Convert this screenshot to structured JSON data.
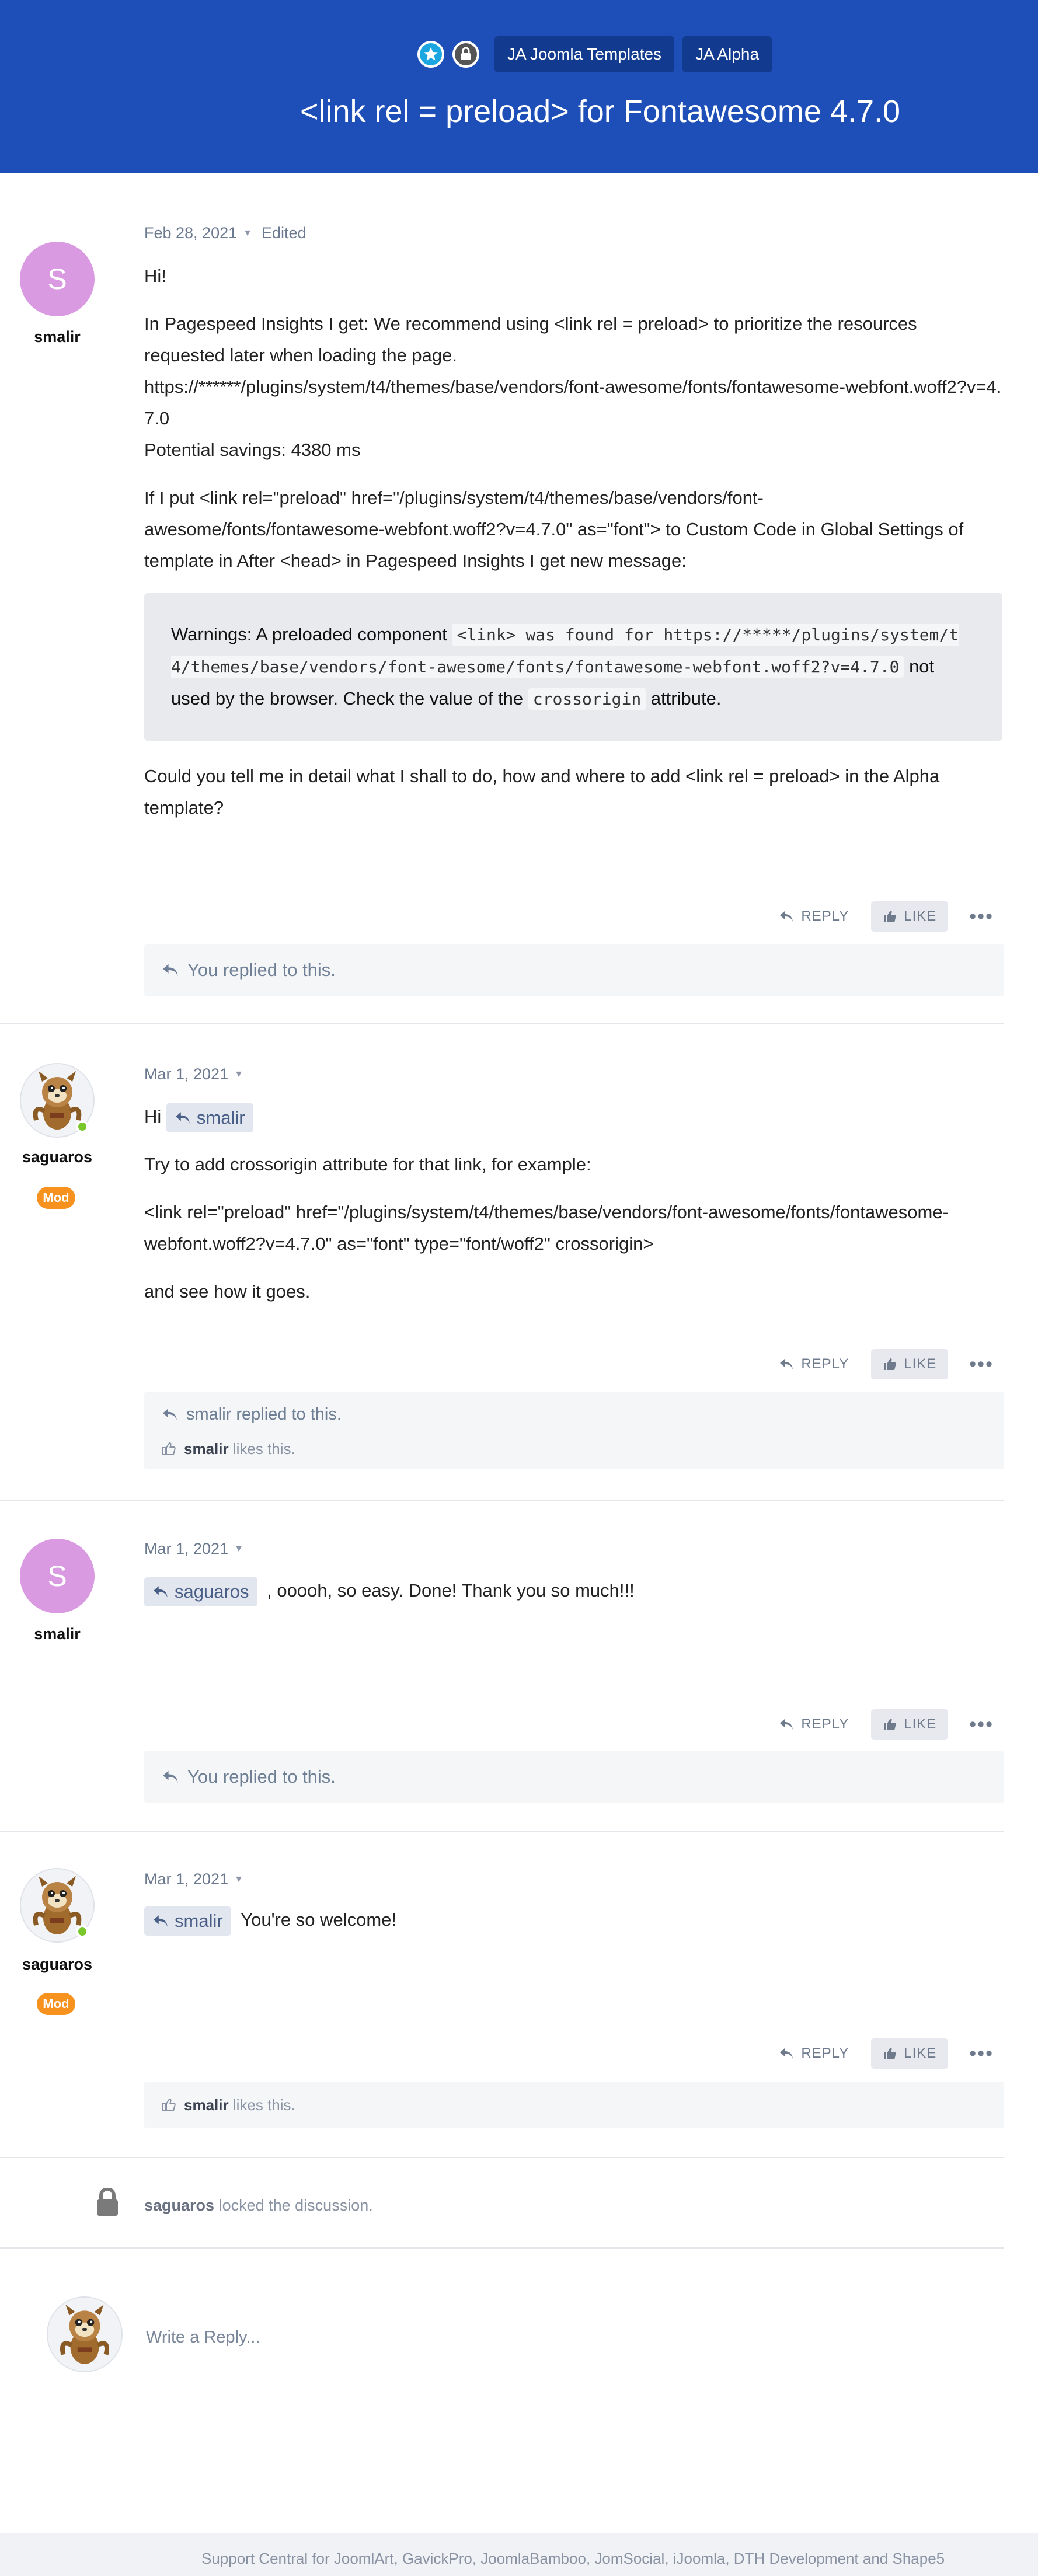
{
  "header": {
    "title": "<link rel = preload> for Fontawesome 4.7.0",
    "tags": [
      "JA Joomla Templates",
      "JA Alpha"
    ]
  },
  "posts": [
    {
      "author": "smalir",
      "avatar_letter": "S",
      "date": "Feb 28, 2021",
      "edited": "Edited",
      "p1": "Hi!",
      "p2a": "In Pagespeed Insights I get: We recommend using <link rel = preload> to prioritize the resources requested later when loading the page.",
      "p2b": "https://******/plugins/system/t4/themes/base/vendors/font-awesome/fonts/fontawesome-webfont.woff2?v=4.7.0",
      "p2c": "Potential savings: 4380 ms",
      "p3": "If I put <link rel=\"preload\" href=\"/plugins/system/t4/themes/base/vendors/font-awesome/fonts/fontawesome-webfont.woff2?v=4.7.0\" as=\"font\"> to Custom Code in Global Settings of template in After <head> in Pagespeed Insights I get new message:",
      "quote": {
        "a": "Warnings: A preloaded component ",
        "code1": "<link> was found for https://*****/plugins/system/t4/themes/base/vendors/font-awesome/fonts/fontawesome-webfont.woff2?v=4.7.0",
        "b": " not used by the browser. Check the value of the ",
        "code2": "crossorigin",
        "c": " attribute."
      },
      "p4": "Could you tell me in detail what I shall to do, how and where to add <link rel = preload> in the Alpha template?",
      "replied": "You replied to this."
    },
    {
      "author": "saguaros",
      "badge": "Mod",
      "date": "Mar 1, 2021",
      "hi": "Hi",
      "mention": "smalir",
      "p1": "Try to add crossorigin attribute for that link, for example:",
      "p2": "<link rel=\"preload\" href=\"/plugins/system/t4/themes/base/vendors/font-awesome/fonts/fontawesome-webfont.woff2?v=4.7.0\" as=\"font\" type=\"font/woff2\" crossorigin>",
      "p3": "and see how it goes.",
      "replied": "smalir replied to this.",
      "likes_user": "smalir",
      "likes_text": "likes this."
    },
    {
      "author": "smalir",
      "avatar_letter": "S",
      "date": "Mar 1, 2021",
      "mention": "saguaros",
      "text": ", ooooh, so easy. Done! Thank you so much!!!",
      "replied": "You replied to this."
    },
    {
      "author": "saguaros",
      "badge": "Mod",
      "date": "Mar 1, 2021",
      "mention": "smalir",
      "text": "You're so welcome!",
      "likes_user": "smalir",
      "likes_text": "likes this."
    }
  ],
  "actions": {
    "reply": "REPLY",
    "like": "LIKE",
    "more": "•••"
  },
  "locked": {
    "user": "saguaros",
    "text": "locked the discussion."
  },
  "composer": {
    "placeholder": "Write a Reply..."
  },
  "footer": {
    "text": "Support Central for JoomlArt, GavickPro, JoomlaBamboo, JomSocial, iJoomla, DTH Development and Shape5"
  },
  "colors": {
    "header_bg": "#1e4fb8",
    "tag_bg": "#123a8e",
    "mod_badge": "#f7921e",
    "online": "#7ac72b",
    "letter_avatar": "#d99ae2"
  }
}
